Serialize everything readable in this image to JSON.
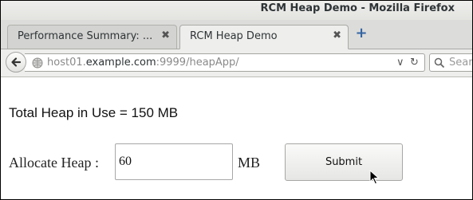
{
  "window": {
    "title": "RCM Heap Demo - Mozilla Firefox"
  },
  "tabs": [
    {
      "label": "Performance Summary: ...",
      "close": "✖",
      "active": false
    },
    {
      "label": "RCM Heap Demo",
      "close": "✖",
      "active": true
    }
  ],
  "new_tab": "+",
  "navbar": {
    "url_prefix": "host01.",
    "url_host": "example.com",
    "url_suffix": ":9999/heapApp/",
    "dropdown": "∨",
    "reload": "↻",
    "search_placeholder": "Sear"
  },
  "page": {
    "heap_text": "Total Heap in Use = 150 MB",
    "allocate_label": "Allocate Heap :",
    "allocate_value": "60",
    "unit": "MB",
    "submit_label": "Submit"
  },
  "icons": [
    "back-arrow-icon",
    "globe-icon",
    "search-icon",
    "mouse-pointer-icon"
  ],
  "colors": {
    "accent_blue": "#3465a4",
    "page_background": "#ffffff",
    "chrome_background": "#e8e8e7"
  }
}
